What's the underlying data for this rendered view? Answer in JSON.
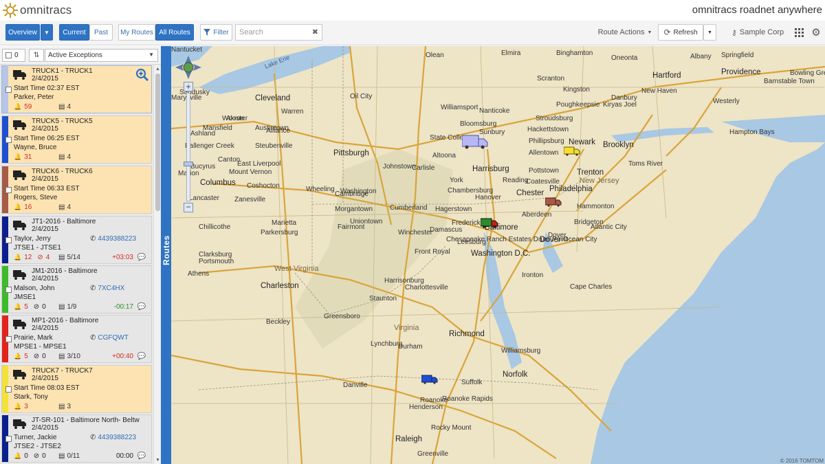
{
  "header": {
    "logo_text": "omnitracs",
    "app_title": "omnitracs roadnet anywhere"
  },
  "toolbar": {
    "overview": "Overview",
    "current": "Current",
    "past": "Past",
    "my_routes": "My Routes",
    "all_routes": "All Routes",
    "filter": "Filter",
    "search_placeholder": "Search",
    "route_actions": "Route Actions",
    "refresh": "Refresh",
    "account": "Sample Corp"
  },
  "panel": {
    "selected_count": "0",
    "filter_value": "Active Exceptions",
    "tab_label": "Routes"
  },
  "routes": [
    {
      "name": "TRUCK1 - TRUCK1",
      "date": "2/4/2015",
      "line3": "Start Time 02:37 EST",
      "line4": "Parker, Peter",
      "exceptions": "59",
      "stops": "4",
      "stripe": "#b6c6e6",
      "alert": true
    },
    {
      "name": "TRUCK5 - TRUCK5",
      "date": "2/4/2015",
      "line3": "Start Time 06:25 EST",
      "line4": "Wayne, Bruce",
      "exceptions": "31",
      "stops": "4",
      "stripe": "#1d4fcf",
      "alert": true
    },
    {
      "name": "TRUCK6 - TRUCK6",
      "date": "2/4/2015",
      "line3": "Start Time 06:33 EST",
      "line4": "Rogers, Steve",
      "exceptions": "16",
      "stops": "4",
      "stripe": "#a65a48",
      "alert": true
    },
    {
      "name": "JT1-2016 - Baltimore",
      "date": "2/4/2015",
      "line3": "Taylor, Jerry",
      "phone": "4439388223",
      "line4": "JTSE1 - JTSE1",
      "exceptions": "12",
      "clock": "4",
      "stops": "5/14",
      "delta": "+03:03",
      "stripe": "#0c1f8c",
      "alert": false
    },
    {
      "name": "JM1-2016 - Baltimore",
      "date": "2/4/2015",
      "line3": "Malson, John",
      "phone": "7XC4HX",
      "line4": "JMSE1",
      "exceptions": "5",
      "clock": "0",
      "stops": "1/9",
      "delta": "-00:17",
      "stripe": "#3dbb2a",
      "alert": false
    },
    {
      "name": "MP1-2016 - Baltimore",
      "date": "2/4/2015",
      "line3": "Prairie, Mark",
      "phone": "CGFQWT",
      "line4": "MPSE1 - MPSE1",
      "exceptions": "5",
      "clock": "0",
      "stops": "3/10",
      "delta": "+00:40",
      "stripe": "#e0241c",
      "alert": false
    },
    {
      "name": "TRUCK7 - TRUCK7",
      "date": "2/4/2015",
      "line3": "Start Time 08:03 EST",
      "line4": "Stark, Tony",
      "exceptions": "3",
      "stops": "3",
      "stripe": "#f2e23a",
      "alert": true
    },
    {
      "name": "JT-SR-101 - Baltimore North- Beltw",
      "date": "2/4/2015",
      "line3": "Turner, Jackie",
      "phone": "4439388223",
      "line4": "JTSE2 - JTSE2",
      "exceptions": "0",
      "clock": "0",
      "stops": "0/11",
      "delta": "00:00",
      "stripe": "#0c1f8c",
      "alert": false
    }
  ],
  "map": {
    "copyright": "© 2016 TOMTOM",
    "cities": [
      {
        "n": "Cleveland",
        "big": true
      },
      {
        "n": "Pittsburgh",
        "big": true
      },
      {
        "n": "Columbus",
        "big": true
      },
      {
        "n": "Harrisburg",
        "big": true
      },
      {
        "n": "Philadelphia",
        "big": true
      },
      {
        "n": "Baltimore",
        "big": true
      },
      {
        "n": "Washington D.C.",
        "big": true
      },
      {
        "n": "Richmond",
        "big": true
      },
      {
        "n": "Norfolk",
        "big": true
      },
      {
        "n": "Raleigh",
        "big": true
      },
      {
        "n": "Charleston",
        "big": true
      },
      {
        "n": "Hartford",
        "big": true
      },
      {
        "n": "Providence",
        "big": true
      },
      {
        "n": "Brooklyn",
        "big": true
      },
      {
        "n": "Newark",
        "big": true
      },
      {
        "n": "Trenton",
        "big": true
      },
      {
        "n": "Dover",
        "big": true
      },
      {
        "n": "Chester",
        "big": true
      },
      {
        "n": "Olean"
      },
      {
        "n": "Elmira"
      },
      {
        "n": "Binghamton"
      },
      {
        "n": "Oneonta"
      },
      {
        "n": "Albany"
      },
      {
        "n": "Springfield"
      },
      {
        "n": "Sandusky"
      },
      {
        "n": "Akron"
      },
      {
        "n": "Warren"
      },
      {
        "n": "Oil City"
      },
      {
        "n": "Williamsport"
      },
      {
        "n": "Bloomsburg"
      },
      {
        "n": "Sunbury"
      },
      {
        "n": "Scranton"
      },
      {
        "n": "Allentown"
      },
      {
        "n": "State College"
      },
      {
        "n": "Altoona"
      },
      {
        "n": "Johnstown"
      },
      {
        "n": "Wheeling"
      },
      {
        "n": "Zanesville"
      },
      {
        "n": "Lancaster"
      },
      {
        "n": "Marietta"
      },
      {
        "n": "Parkersburg"
      },
      {
        "n": "Morgantown"
      },
      {
        "n": "Cumberland"
      },
      {
        "n": "Hagerstown"
      },
      {
        "n": "Frederick"
      },
      {
        "n": "Winchester"
      },
      {
        "n": "Front Royal"
      },
      {
        "n": "Harrisonburg"
      },
      {
        "n": "Staunton"
      },
      {
        "n": "Charlottesville"
      },
      {
        "n": "Lynchburg"
      },
      {
        "n": "Roanoke"
      },
      {
        "n": "Danville"
      },
      {
        "n": "Durham"
      },
      {
        "n": "Greensboro"
      },
      {
        "n": "Rocky Mount"
      },
      {
        "n": "Greenville"
      },
      {
        "n": "Williamsburg"
      },
      {
        "n": "Suffolk"
      },
      {
        "n": "Roanoke Rapids"
      },
      {
        "n": "Henderson"
      },
      {
        "n": "Beckley"
      },
      {
        "n": "Portsmouth"
      },
      {
        "n": "Chillicothe"
      },
      {
        "n": "Canton"
      },
      {
        "n": "Steubenville"
      },
      {
        "n": "Dover"
      },
      {
        "n": "Toms River"
      },
      {
        "n": "Atlantic City"
      },
      {
        "n": "Ocean City"
      },
      {
        "n": "Bridgeton"
      },
      {
        "n": "Hammonton"
      },
      {
        "n": "Pottstown"
      },
      {
        "n": "Stroudsburg"
      },
      {
        "n": "Kingston"
      },
      {
        "n": "Poughkeepsie"
      },
      {
        "n": "Danbury"
      },
      {
        "n": "New Haven"
      },
      {
        "n": "Westerly"
      },
      {
        "n": "Hampton Bays"
      },
      {
        "n": "Barnstable Town"
      },
      {
        "n": "Kiryas Joel"
      },
      {
        "n": "Nanticoke"
      },
      {
        "n": "Hackettstown"
      },
      {
        "n": "Phillipsburg"
      },
      {
        "n": "Reading"
      },
      {
        "n": "York"
      },
      {
        "n": "Chambersburg"
      },
      {
        "n": "Hanover"
      },
      {
        "n": "Carlisle"
      },
      {
        "n": "Coatesville"
      },
      {
        "n": "Aberdeen"
      },
      {
        "n": "Leesburg"
      },
      {
        "n": "Ashland"
      },
      {
        "n": "Mansfield"
      },
      {
        "n": "Wooster"
      },
      {
        "n": "Austintown"
      },
      {
        "n": "Alliance"
      },
      {
        "n": "East Liverpool"
      },
      {
        "n": "Mount Vernon"
      },
      {
        "n": "Coshocton"
      },
      {
        "n": "Cambridge"
      },
      {
        "n": "Washington"
      },
      {
        "n": "Uniontown"
      },
      {
        "n": "Fairmont"
      },
      {
        "n": "Clarksburg"
      },
      {
        "n": "Athens"
      },
      {
        "n": "Ironton"
      },
      {
        "n": "Cape Charles"
      },
      {
        "n": "Chesapeake Ranch Estates Drum Point"
      },
      {
        "n": "Damascus"
      },
      {
        "n": "Ballenger Creek"
      },
      {
        "n": "Bucyrus"
      },
      {
        "n": "Marion"
      },
      {
        "n": "Marysville"
      },
      {
        "n": "Bowling Green"
      },
      {
        "n": "Nantucket"
      }
    ],
    "states": [
      "New Jersey",
      "Virginia",
      "West Virginia"
    ],
    "lake": "Lake Erie"
  }
}
